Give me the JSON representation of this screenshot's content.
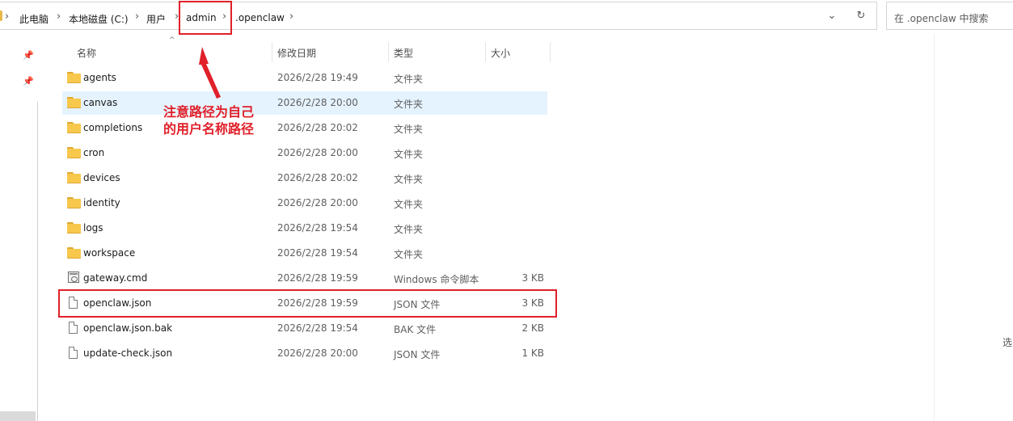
{
  "breadcrumb": {
    "items": [
      "此电脑",
      "本地磁盘 (C:)",
      "用户",
      "admin",
      ".openclaw"
    ]
  },
  "search": {
    "placeholder": "在 .openclaw 中搜索"
  },
  "columns": {
    "name": "名称",
    "modified": "修改日期",
    "type": "类型",
    "size": "大小"
  },
  "files": [
    {
      "name": "agents",
      "modified": "2026/2/28 19:49",
      "type": "文件夹",
      "size": "",
      "icon": "folder-icon"
    },
    {
      "name": "canvas",
      "modified": "2026/2/28 20:00",
      "type": "文件夹",
      "size": "",
      "icon": "folder-icon"
    },
    {
      "name": "completions",
      "modified": "2026/2/28 20:02",
      "type": "文件夹",
      "size": "",
      "icon": "folder-icon"
    },
    {
      "name": "cron",
      "modified": "2026/2/28 20:00",
      "type": "文件夹",
      "size": "",
      "icon": "folder-icon"
    },
    {
      "name": "devices",
      "modified": "2026/2/28 20:02",
      "type": "文件夹",
      "size": "",
      "icon": "folder-icon"
    },
    {
      "name": "identity",
      "modified": "2026/2/28 20:00",
      "type": "文件夹",
      "size": "",
      "icon": "folder-icon"
    },
    {
      "name": "logs",
      "modified": "2026/2/28 19:54",
      "type": "文件夹",
      "size": "",
      "icon": "folder-icon"
    },
    {
      "name": "workspace",
      "modified": "2026/2/28 19:54",
      "type": "文件夹",
      "size": "",
      "icon": "folder-icon"
    },
    {
      "name": "gateway.cmd",
      "modified": "2026/2/28 19:59",
      "type": "Windows 命令脚本",
      "size": "3 KB",
      "icon": "cmd-file-icon"
    },
    {
      "name": "openclaw.json",
      "modified": "2026/2/28 19:59",
      "type": "JSON 文件",
      "size": "3 KB",
      "icon": "file-icon"
    },
    {
      "name": "openclaw.json.bak",
      "modified": "2026/2/28 19:54",
      "type": "BAK 文件",
      "size": "2 KB",
      "icon": "file-icon"
    },
    {
      "name": "update-check.json",
      "modified": "2026/2/28 20:00",
      "type": "JSON 文件",
      "size": "1 KB",
      "icon": "file-icon"
    }
  ],
  "annotation": {
    "line1": "注意路径为自己",
    "line2": "的用户名称路径"
  },
  "details_hint": "选",
  "colors": {
    "highlight": "#e0202a",
    "selection": "#e5f3ff",
    "folder": "#f7c84c"
  }
}
